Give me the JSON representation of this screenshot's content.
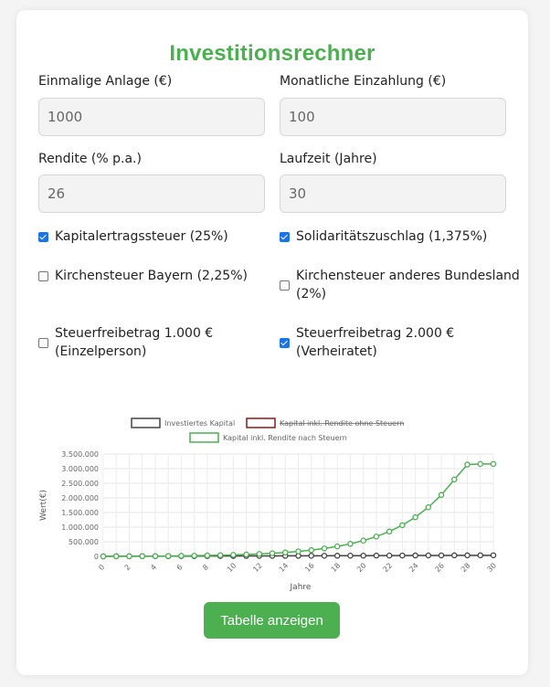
{
  "title": "Investitionsrechner",
  "fields": {
    "einmalige_anlage": {
      "label": "Einmalige Anlage (€)",
      "value": "1000"
    },
    "monatliche_einzahlung": {
      "label": "Monatliche Einzahlung (€)",
      "value": "100"
    },
    "rendite": {
      "label": "Rendite (% p.a.)",
      "value": "26"
    },
    "laufzeit": {
      "label": "Laufzeit (Jahre)",
      "value": "30"
    }
  },
  "checkboxes": {
    "kapitalertragssteuer": {
      "label": "Kapitalertragssteuer (25%)",
      "checked": true
    },
    "soli": {
      "label": "Solidaritätszuschlag (1,375%)",
      "checked": true
    },
    "kirche_bayern": {
      "label": "Kirchensteuer Bayern (2,25%)",
      "checked": false
    },
    "kirche_andere_line1": {
      "label": "Kirchensteuer anderes Bundesland",
      "checked": false
    },
    "kirche_andere_line2": {
      "label": "(2%)"
    },
    "freibetrag_einzel_line1": {
      "label": "Steuerfreibetrag 1.000 €",
      "checked": false
    },
    "freibetrag_einzel_line2": {
      "label": "(Einzelperson)"
    },
    "freibetrag_verh_line1": {
      "label": "Steuerfreibetrag 2.000 €",
      "checked": true
    },
    "freibetrag_verh_line2": {
      "label": "(Verheiratet)"
    }
  },
  "colors": {
    "accent": "#4caf50",
    "checkbox": "#1a73e8",
    "series_invested": "#444444",
    "series_no_tax": "#8b1a1a",
    "series_after_tax": "#4caf50"
  },
  "chart_data": {
    "type": "line",
    "xlabel": "Jahre",
    "ylabel": "Wert(€)",
    "ylim": [
      0,
      3500000
    ],
    "y_ticks": [
      "0",
      "500.000",
      "1.000.000",
      "1.500.000",
      "2.000.000",
      "2.500.000",
      "3.000.000",
      "3.500.000"
    ],
    "x_ticks": [
      "0",
      "2",
      "4",
      "6",
      "8",
      "10",
      "12",
      "14",
      "16",
      "18",
      "20",
      "22",
      "24",
      "26",
      "28",
      "30"
    ],
    "x": [
      0,
      1,
      2,
      3,
      4,
      5,
      6,
      7,
      8,
      9,
      10,
      11,
      12,
      13,
      14,
      15,
      16,
      17,
      18,
      19,
      20,
      21,
      22,
      23,
      24,
      25,
      26,
      27,
      28,
      29,
      30
    ],
    "legend_position": "top",
    "series": [
      {
        "name": "Investiertes Kapital",
        "hidden": false,
        "values": [
          1000,
          2200,
          3400,
          4600,
          5800,
          7000,
          8200,
          9400,
          10600,
          11800,
          13000,
          14200,
          15400,
          16600,
          17800,
          19000,
          20200,
          21400,
          22600,
          23800,
          25000,
          26200,
          27400,
          28600,
          29800,
          31000,
          32200,
          33400,
          34600,
          35800,
          37000
        ]
      },
      {
        "name": "Kapital inkl. Rendite ohne Steuern",
        "hidden": true,
        "values": []
      },
      {
        "name": "Kapital inkl. Rendite nach Steuern",
        "hidden": false,
        "values": [
          1000,
          2500,
          4300,
          6600,
          9500,
          13200,
          17800,
          23500,
          30700,
          39800,
          51200,
          65500,
          83500,
          106000,
          134000,
          169500,
          214000,
          270000,
          340000,
          428000,
          539000,
          677000,
          850000,
          1067000,
          1339000,
          1680000,
          2100000,
          2630000,
          3140000,
          3160000,
          3160000
        ]
      }
    ]
  },
  "button": {
    "label": "Tabelle anzeigen"
  }
}
